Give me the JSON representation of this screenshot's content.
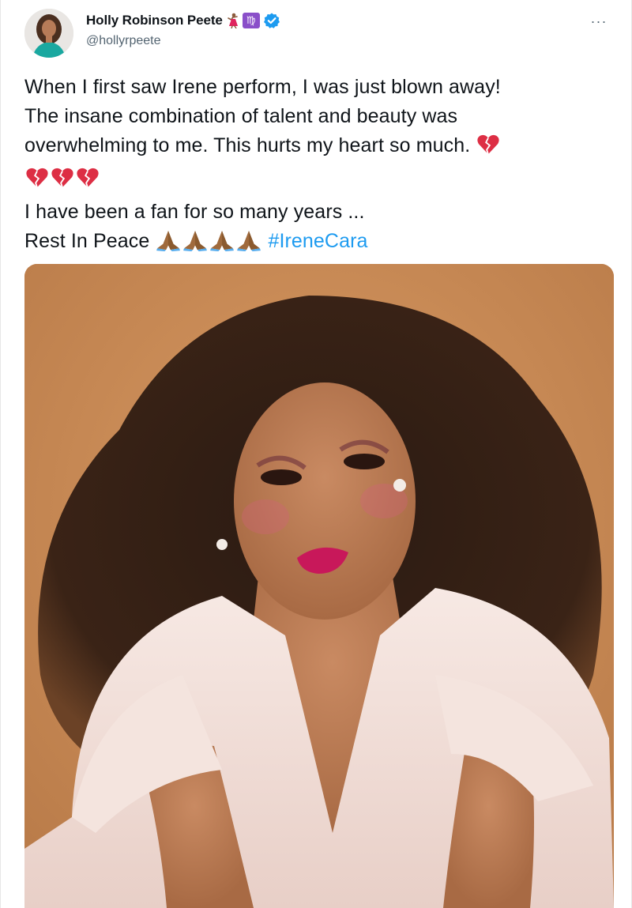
{
  "author": {
    "display_name": "Holly Robinson Peete",
    "handle": "@hollyrpeete",
    "zodiac_badge": "♍",
    "icons": [
      "dancer-emoji",
      "virgo-badge",
      "verified-badge"
    ],
    "verified_color": "#1d9bf0"
  },
  "menu": {
    "more_label": "···"
  },
  "tweet": {
    "line1": "When I first saw Irene perform, I was just blown away!",
    "line2": "The insane combination of talent and beauty was",
    "line3": "overwhelming to me. This hurts my heart so much.",
    "line5": "I have been a fan for so many years ...",
    "line6": "Rest In Peace",
    "hashtag": "#IreneCara",
    "emojis": {
      "broken_heart_count": 4,
      "folded_hands_count": 4
    }
  },
  "colors": {
    "hashtag": "#1d9bf0",
    "secondary_text": "#536471",
    "text": "#0f1419"
  }
}
